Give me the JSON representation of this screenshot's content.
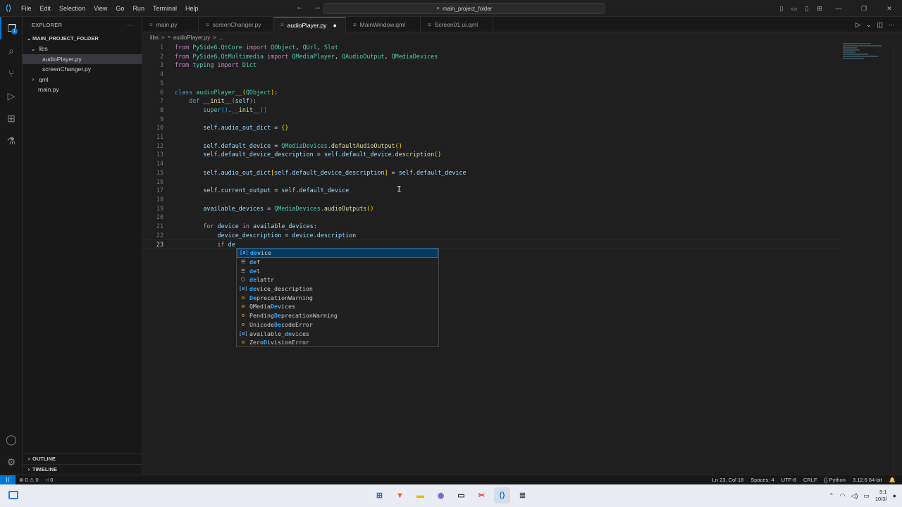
{
  "titlebar": {
    "menu": [
      "File",
      "Edit",
      "Selection",
      "View",
      "Go",
      "Run",
      "Terminal",
      "Help"
    ],
    "search": "main_project_folder"
  },
  "activity_badge": "1",
  "explorer": {
    "title": "EXPLORER",
    "more": "···",
    "folder": "MAIN_PROJECT_FOLDER",
    "tree": [
      {
        "label": "libs",
        "chevron": "⌄"
      },
      {
        "label": "audioPlayer.py",
        "chevron": ""
      },
      {
        "label": "screenChanger.py",
        "chevron": ""
      },
      {
        "label": "qml",
        "chevron": "›"
      },
      {
        "label": "main.py",
        "chevron": ""
      }
    ],
    "outline": "OUTLINE",
    "timeline": "TIMELINE"
  },
  "tabs": [
    {
      "label": "main.py",
      "icon": "≡"
    },
    {
      "label": "screenChanger.py",
      "icon": "≡"
    },
    {
      "label": "audioPlayer.py",
      "icon": "≡"
    },
    {
      "label": "MainWindow.qml",
      "icon": "≡"
    },
    {
      "label": "Screen01.ui.qml",
      "icon": "≡"
    }
  ],
  "breadcrumb": [
    "libs",
    ">",
    "audioPlayer.py",
    ">",
    "..."
  ],
  "line_numbers": [
    "1",
    "2",
    "3",
    "4",
    "5",
    "6",
    "7",
    "8",
    "9",
    "10",
    "11",
    "12",
    "13",
    "14",
    "15",
    "16",
    "17",
    "18",
    "19",
    "20",
    "21",
    "22",
    "23"
  ],
  "suggestions": [
    {
      "pre": "",
      "hl": "de",
      "post": "vice"
    },
    {
      "pre": "",
      "hl": "de",
      "post": "f"
    },
    {
      "pre": "",
      "hl": "de",
      "post": "l"
    },
    {
      "pre": "",
      "hl": "de",
      "post": "lattr"
    },
    {
      "pre": "",
      "hl": "de",
      "post": "vice_description"
    },
    {
      "pre": "",
      "hl": "De",
      "post": "precationWarning"
    },
    {
      "pre": "QMedia",
      "hl": "De",
      "post": "vices"
    },
    {
      "pre": "Pending",
      "hl": "De",
      "post": "precationWarning"
    },
    {
      "pre": "Unicode",
      "hl": "De",
      "post": "codeError"
    },
    {
      "pre": "available_",
      "hl": "de",
      "post": "vices"
    },
    {
      "pre": "Zero",
      "hl": "D",
      "post": "ivisionError"
    }
  ],
  "status": {
    "errors": "0",
    "warnings": "0",
    "ports": "0",
    "position": "Ln 23, Col 18",
    "spaces": "Spaces: 4",
    "encoding": "UTF-8",
    "eol": "CRLF",
    "language": "Python",
    "interpreter": "3.12.6 64-bit"
  },
  "taskbar": {
    "time": "5:1",
    "date": "10/3/"
  }
}
